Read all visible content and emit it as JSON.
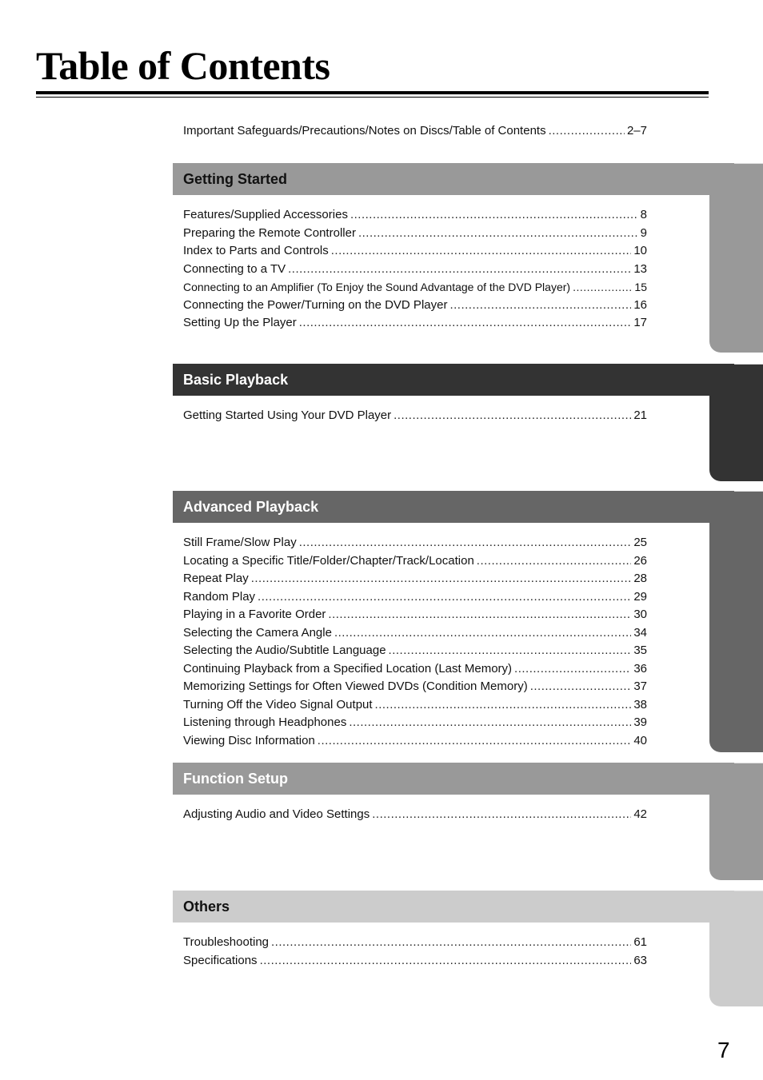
{
  "page": {
    "title": "Table of Contents",
    "page_number": "7"
  },
  "intro": {
    "label": "Important Safeguards/Precautions/Notes on Discs/Table of Contents",
    "page": "2–7"
  },
  "sections": [
    {
      "title": "Getting Started",
      "color": "#999999",
      "title_color": "#111111",
      "entries": [
        {
          "label": "Features/Supplied Accessories",
          "page": "8"
        },
        {
          "label": "Preparing the Remote Controller",
          "page": "9"
        },
        {
          "label": "Index to Parts and Controls",
          "page": "10"
        },
        {
          "label": "Connecting to a TV",
          "page": "13"
        },
        {
          "label": "Connecting to an Amplifier (To Enjoy the Sound Advantage of the DVD Player)",
          "page": "15"
        },
        {
          "label": "Connecting the Power/Turning on the DVD Player",
          "page": "16"
        },
        {
          "label": "Setting Up the Player",
          "page": "17"
        }
      ]
    },
    {
      "title": "Basic Playback",
      "color": "#333333",
      "title_color": "#ffffff",
      "entries": [
        {
          "label": "Getting Started Using Your DVD Player",
          "page": "21"
        }
      ]
    },
    {
      "title": "Advanced Playback",
      "color": "#666666",
      "title_color": "#ffffff",
      "entries": [
        {
          "label": "Still Frame/Slow Play",
          "page": "25"
        },
        {
          "label": "Locating a Specific Title/Folder/Chapter/Track/Location",
          "page": "26"
        },
        {
          "label": "Repeat Play",
          "page": "28"
        },
        {
          "label": "Random Play",
          "page": "29"
        },
        {
          "label": "Playing in a Favorite Order",
          "page": "30"
        },
        {
          "label": "Selecting the Camera Angle",
          "page": "34"
        },
        {
          "label": "Selecting the Audio/Subtitle Language",
          "page": "35"
        },
        {
          "label": "Continuing Playback from a Specified Location (Last Memory)",
          "page": "36"
        },
        {
          "label": "Memorizing Settings for Often Viewed DVDs (Condition Memory)",
          "page": "37"
        },
        {
          "label": "Turning Off the Video Signal Output",
          "page": "38"
        },
        {
          "label": "Listening through Headphones",
          "page": "39"
        },
        {
          "label": "Viewing Disc Information",
          "page": "40"
        }
      ]
    },
    {
      "title": "Function Setup",
      "color": "#999999",
      "title_color": "#ffffff",
      "entries": [
        {
          "label": "Adjusting Audio and Video Settings",
          "page": "42"
        }
      ]
    },
    {
      "title": "Others",
      "color": "#cccccc",
      "title_color": "#111111",
      "entries": [
        {
          "label": "Troubleshooting",
          "page": "61"
        },
        {
          "label": "Specifications",
          "page": "63"
        }
      ]
    }
  ]
}
